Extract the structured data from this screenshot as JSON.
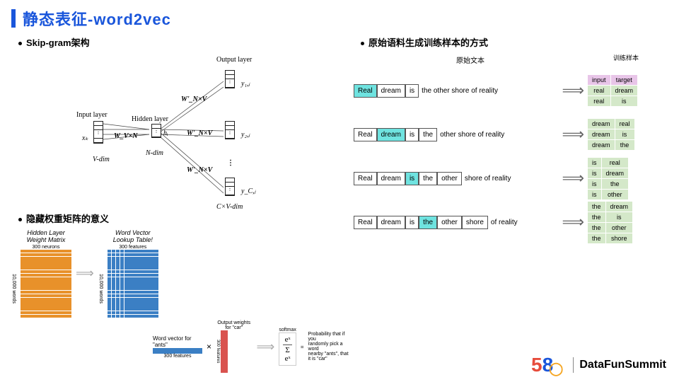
{
  "title": "静态表征-word2vec",
  "left": {
    "arch_heading": "Skip-gram架构",
    "labels": {
      "output_layer": "Output layer",
      "input_layer": "Input layer",
      "hidden_layer": "Hidden layer",
      "y1": "y₁,ⱼ",
      "y2": "y₂,ⱼ",
      "yc": "y_C,ⱼ",
      "xk": "xₖ",
      "h1": "hᵢ",
      "W_VN": "W_V×N",
      "Wp_NV1": "W'_N×V",
      "Wp_NV2": "W'_N×V",
      "Wp_NV3": "W'_N×V",
      "Vdim": "V-dim",
      "Ndim": "N-dim",
      "CVdim": "C×V-dim"
    },
    "weight_heading": "隐藏权重矩阵的意义",
    "hidden_matrix_title": "Hidden Layer\nWeight Matrix",
    "lookup_title": "Word Vector\nLookup Table!",
    "neurons_label": "300  neurons",
    "features_label": "300  features",
    "words_label": "10,000  words",
    "softmax": {
      "out_weights": "Output weights for \"car\"",
      "wv_label": "Word vector for \"ants\"",
      "wv_features": "300 features",
      "out_features": "300 features",
      "times": "×",
      "softmax_label": "softmax",
      "formula_top": "eˣ",
      "formula_bot": "Σ eˣ",
      "equals": "=",
      "prob_text": "Probability that if you\nrandomly pick a word\nnearby \"ants\", that it is \"car\""
    }
  },
  "right": {
    "heading": "原始语料生成训练样本的方式",
    "orig_text_label": "原始文本",
    "train_sample_label": "训练样本",
    "table_headers": [
      "input",
      "target"
    ],
    "rows": [
      {
        "words": [
          "Real",
          "dream",
          "is"
        ],
        "hi_index": 0,
        "rest": "the other shore of reality",
        "pairs": [
          [
            "real",
            "dream"
          ],
          [
            "real",
            "is"
          ]
        ]
      },
      {
        "words": [
          "Real",
          "dream",
          "is",
          "the"
        ],
        "hi_index": 1,
        "rest": "other shore of reality",
        "pairs": [
          [
            "dream",
            "real"
          ],
          [
            "dream",
            "is"
          ],
          [
            "dream",
            "the"
          ]
        ]
      },
      {
        "words": [
          "Real",
          "dream",
          "is",
          "the",
          "other"
        ],
        "hi_index": 2,
        "rest": "shore of reality",
        "pairs": [
          [
            "is",
            "real"
          ],
          [
            "is",
            "dream"
          ],
          [
            "is",
            "the"
          ],
          [
            "is",
            "other"
          ]
        ]
      },
      {
        "words": [
          "Real",
          "dream",
          "is",
          "the",
          "other",
          "shore"
        ],
        "hi_index": 3,
        "rest": "of reality",
        "pairs": [
          [
            "the",
            "dream"
          ],
          [
            "the",
            "is"
          ],
          [
            "the",
            "other"
          ],
          [
            "the",
            "shore"
          ]
        ]
      }
    ]
  },
  "footer": {
    "brand_5": "5",
    "brand_8": "8",
    "summit": "DataFunSummit"
  }
}
